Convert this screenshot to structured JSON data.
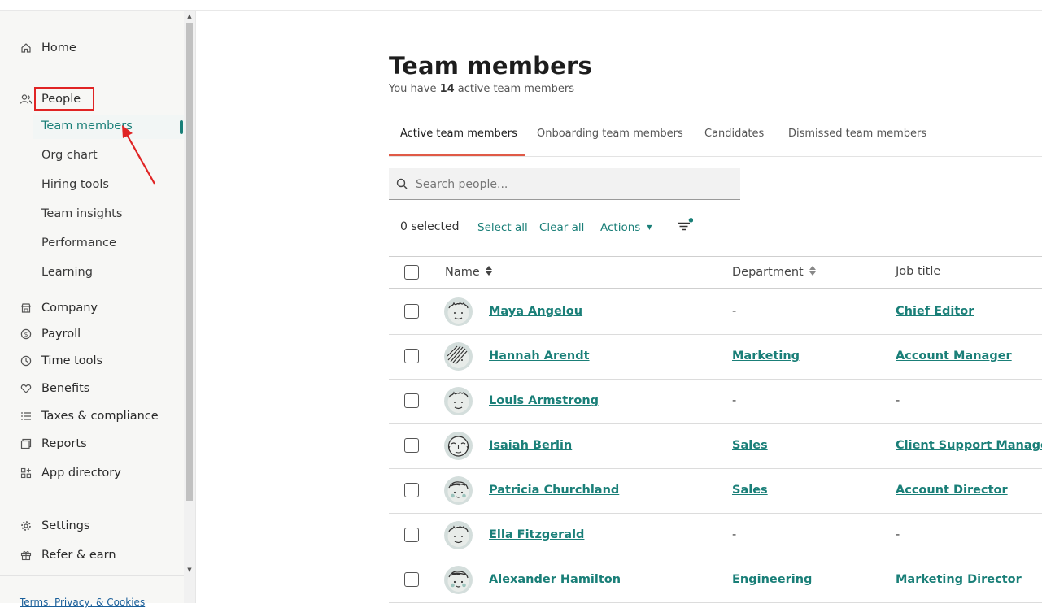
{
  "sidebar": {
    "home": "Home",
    "people": "People",
    "people_sub": [
      "Team members",
      "Org chart",
      "Hiring tools",
      "Team insights",
      "Performance",
      "Learning"
    ],
    "company": "Company",
    "payroll": "Payroll",
    "time_tools": "Time tools",
    "benefits": "Benefits",
    "taxes": "Taxes & compliance",
    "reports": "Reports",
    "app_directory": "App directory",
    "settings": "Settings",
    "refer": "Refer & earn",
    "footer": "Terms, Privacy, & Cookies"
  },
  "main": {
    "title": "Team members",
    "subtitle_prefix": "You have ",
    "subtitle_count": "14",
    "subtitle_suffix": " active team members",
    "tabs": [
      "Active team members",
      "Onboarding team members",
      "Candidates",
      "Dismissed team members"
    ],
    "search_placeholder": "Search people...",
    "selected": "0 selected",
    "select_all": "Select all",
    "clear_all": "Clear all",
    "actions": "Actions",
    "columns": [
      "Name",
      "Department",
      "Job title"
    ]
  },
  "rows": [
    {
      "name": "Maya Angelou",
      "department": "-",
      "title": "Chief Editor",
      "avatar": "curly"
    },
    {
      "name": "Hannah Arendt",
      "department": "Marketing",
      "title": "Account Manager",
      "avatar": "slash"
    },
    {
      "name": "Louis Armstrong",
      "department": "-",
      "title": "-",
      "avatar": "curly"
    },
    {
      "name": "Isaiah Berlin",
      "department": "Sales",
      "title": "Client Support Manager",
      "avatar": "bald"
    },
    {
      "name": "Patricia Churchland",
      "department": "Sales",
      "title": "Account Director",
      "avatar": "wave"
    },
    {
      "name": "Ella Fitzgerald",
      "department": "-",
      "title": "-",
      "avatar": "curly"
    },
    {
      "name": "Alexander Hamilton",
      "department": "Engineering",
      "title": "Marketing Director",
      "avatar": "wave"
    }
  ],
  "colors": {
    "accent": "#1a7f78",
    "tab_underline": "#e05a47",
    "highlight_box": "#e02424"
  }
}
